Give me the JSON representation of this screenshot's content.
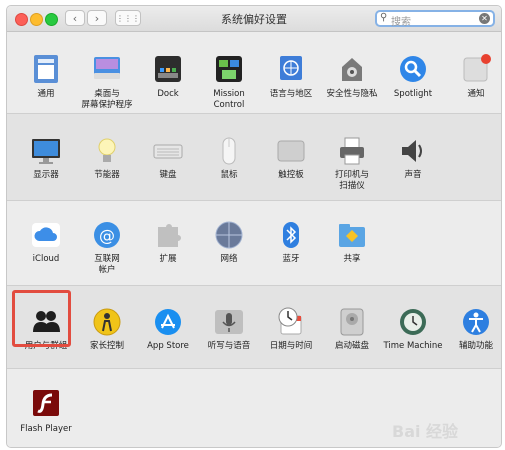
{
  "window": {
    "title": "系统偏好设置",
    "search_placeholder": "搜索",
    "grid_button": "⋮⋮⋮"
  },
  "rows": [
    {
      "items": [
        {
          "label": "通用",
          "icon": "general-icon"
        },
        {
          "label": "桌面与\n屏幕保护程序",
          "icon": "desktop-icon"
        },
        {
          "label": "Dock",
          "icon": "dock-icon"
        },
        {
          "label": "Mission\nControl",
          "icon": "mission-control-icon"
        },
        {
          "label": "语言与地区",
          "icon": "language-region-icon"
        },
        {
          "label": "安全性与隐私",
          "icon": "security-icon"
        },
        {
          "label": "Spotlight",
          "icon": "spotlight-icon"
        },
        {
          "label": "通知",
          "icon": "notifications-icon"
        }
      ]
    },
    {
      "items": [
        {
          "label": "显示器",
          "icon": "displays-icon"
        },
        {
          "label": "节能器",
          "icon": "energy-saver-icon"
        },
        {
          "label": "键盘",
          "icon": "keyboard-icon"
        },
        {
          "label": "鼠标",
          "icon": "mouse-icon"
        },
        {
          "label": "触控板",
          "icon": "trackpad-icon"
        },
        {
          "label": "打印机与\n扫描仪",
          "icon": "printer-icon"
        },
        {
          "label": "声音",
          "icon": "sound-icon"
        }
      ]
    },
    {
      "items": [
        {
          "label": "iCloud",
          "icon": "icloud-icon"
        },
        {
          "label": "互联网\n帐户",
          "icon": "internet-accounts-icon"
        },
        {
          "label": "扩展",
          "icon": "extensions-icon"
        },
        {
          "label": "网络",
          "icon": "network-icon"
        },
        {
          "label": "蓝牙",
          "icon": "bluetooth-icon"
        },
        {
          "label": "共享",
          "icon": "sharing-icon"
        }
      ]
    },
    {
      "items": [
        {
          "label": "用户与群组",
          "icon": "users-groups-icon"
        },
        {
          "label": "家长控制",
          "icon": "parental-controls-icon"
        },
        {
          "label": "App Store",
          "icon": "app-store-icon"
        },
        {
          "label": "听写与语音",
          "icon": "dictation-icon"
        },
        {
          "label": "日期与时间",
          "icon": "date-time-icon"
        },
        {
          "label": "启动磁盘",
          "icon": "startup-disk-icon"
        },
        {
          "label": "Time Machine",
          "icon": "time-machine-icon"
        },
        {
          "label": "辅助功能",
          "icon": "accessibility-icon"
        }
      ]
    },
    {
      "items": [
        {
          "label": "Flash Player",
          "icon": "flash-player-icon"
        }
      ]
    }
  ],
  "highlighted_item": "用户与群组",
  "watermark": "Bai 经验"
}
